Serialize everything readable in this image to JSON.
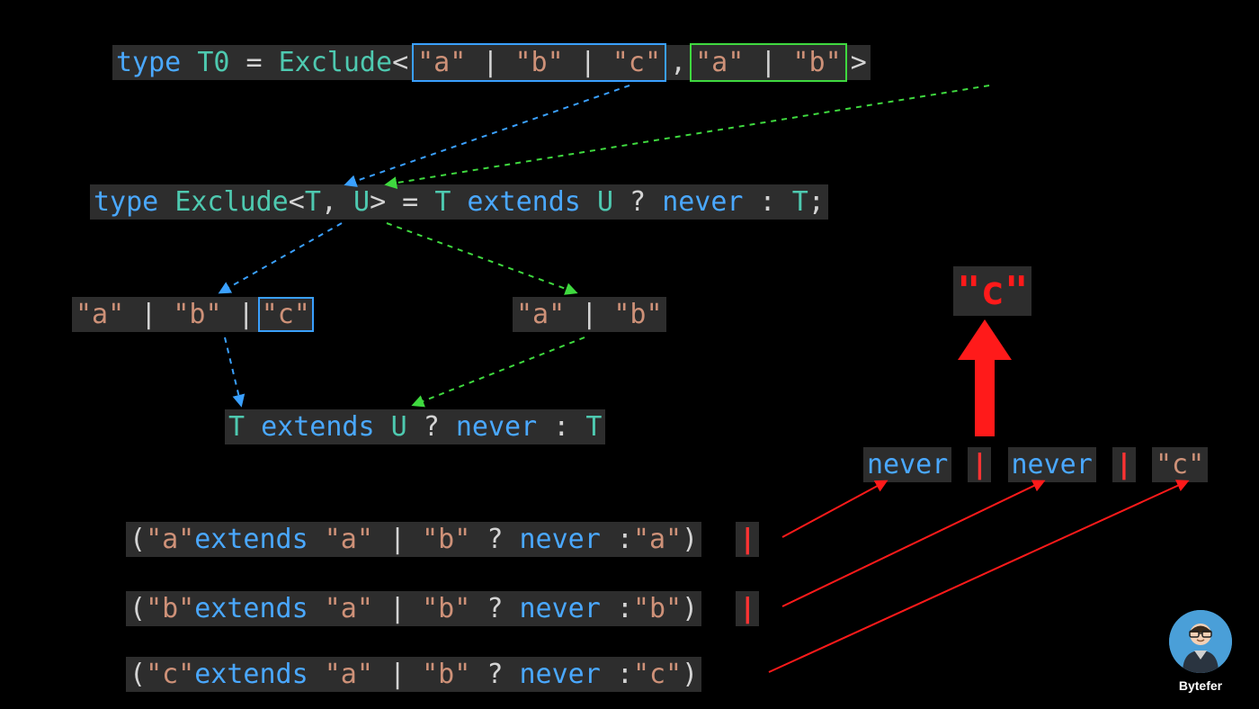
{
  "line1": {
    "type": "type ",
    "name": "T0",
    "eq": " = ",
    "util": "Exclude",
    "lt": "<",
    "box1_a": "\"a\"",
    "box1_p1": " | ",
    "box1_b": "\"b\"",
    "box1_p2": " | ",
    "box1_c": "\"c\"",
    "comma": ", ",
    "box2_a": "\"a\"",
    "box2_p1": " | ",
    "box2_b": "\"b\"",
    "gt": ">"
  },
  "line2": {
    "type": "type ",
    "util": "Exclude",
    "lt": "<",
    "T": "T",
    "comma": ", ",
    "U": "U",
    "gt": ">",
    "eq": " = ",
    "T2": "T",
    "ext": " extends ",
    "U2": "U",
    "q": " ? ",
    "never": "never",
    "col": " : ",
    "T3": "T",
    "semi": ";"
  },
  "line3L": {
    "a": "\"a\"",
    "p1": " | ",
    "b": "\"b\"",
    "p2": " | ",
    "c": "\"c\""
  },
  "line3R": {
    "a": "\"a\"",
    "p1": " | ",
    "b": "\"b\""
  },
  "line4": {
    "T": "T",
    "ext": " extends ",
    "U": "U",
    "q": " ? ",
    "never": "never",
    "col": " : ",
    "T2": "T"
  },
  "result_c": "\"c\"",
  "result_line": {
    "n1": "never",
    "p1": "|",
    "n2": "never",
    "p2": "|",
    "c": "\"c\""
  },
  "dist": {
    "l1_open": "(",
    "l1_a": "\"a\"",
    "l1_ext": "extends ",
    "l1_au": "\"a\"",
    "l1_p": " | ",
    "l1_bu": "\"b\"",
    "l1_q": " ? ",
    "l1_never": "never",
    "l1_col": " :",
    "l1_r": "\"a\"",
    "l1_close": ")",
    "l2_open": "(",
    "l2_a": "\"b\"",
    "l2_ext": "extends ",
    "l2_au": "\"a\"",
    "l2_p": " | ",
    "l2_bu": "\"b\"",
    "l2_q": " ? ",
    "l2_never": "never",
    "l2_col": " :",
    "l2_r": "\"b\"",
    "l2_close": ")",
    "l3_open": "(",
    "l3_a": "\"c\"",
    "l3_ext": "extends ",
    "l3_au": "\"a\"",
    "l3_p": " | ",
    "l3_bu": "\"b\"",
    "l3_q": " ? ",
    "l3_never": "never",
    "l3_col": " :",
    "l3_r": "\"c\"",
    "l3_close": ")",
    "bar": "|"
  },
  "author": "Bytefer"
}
